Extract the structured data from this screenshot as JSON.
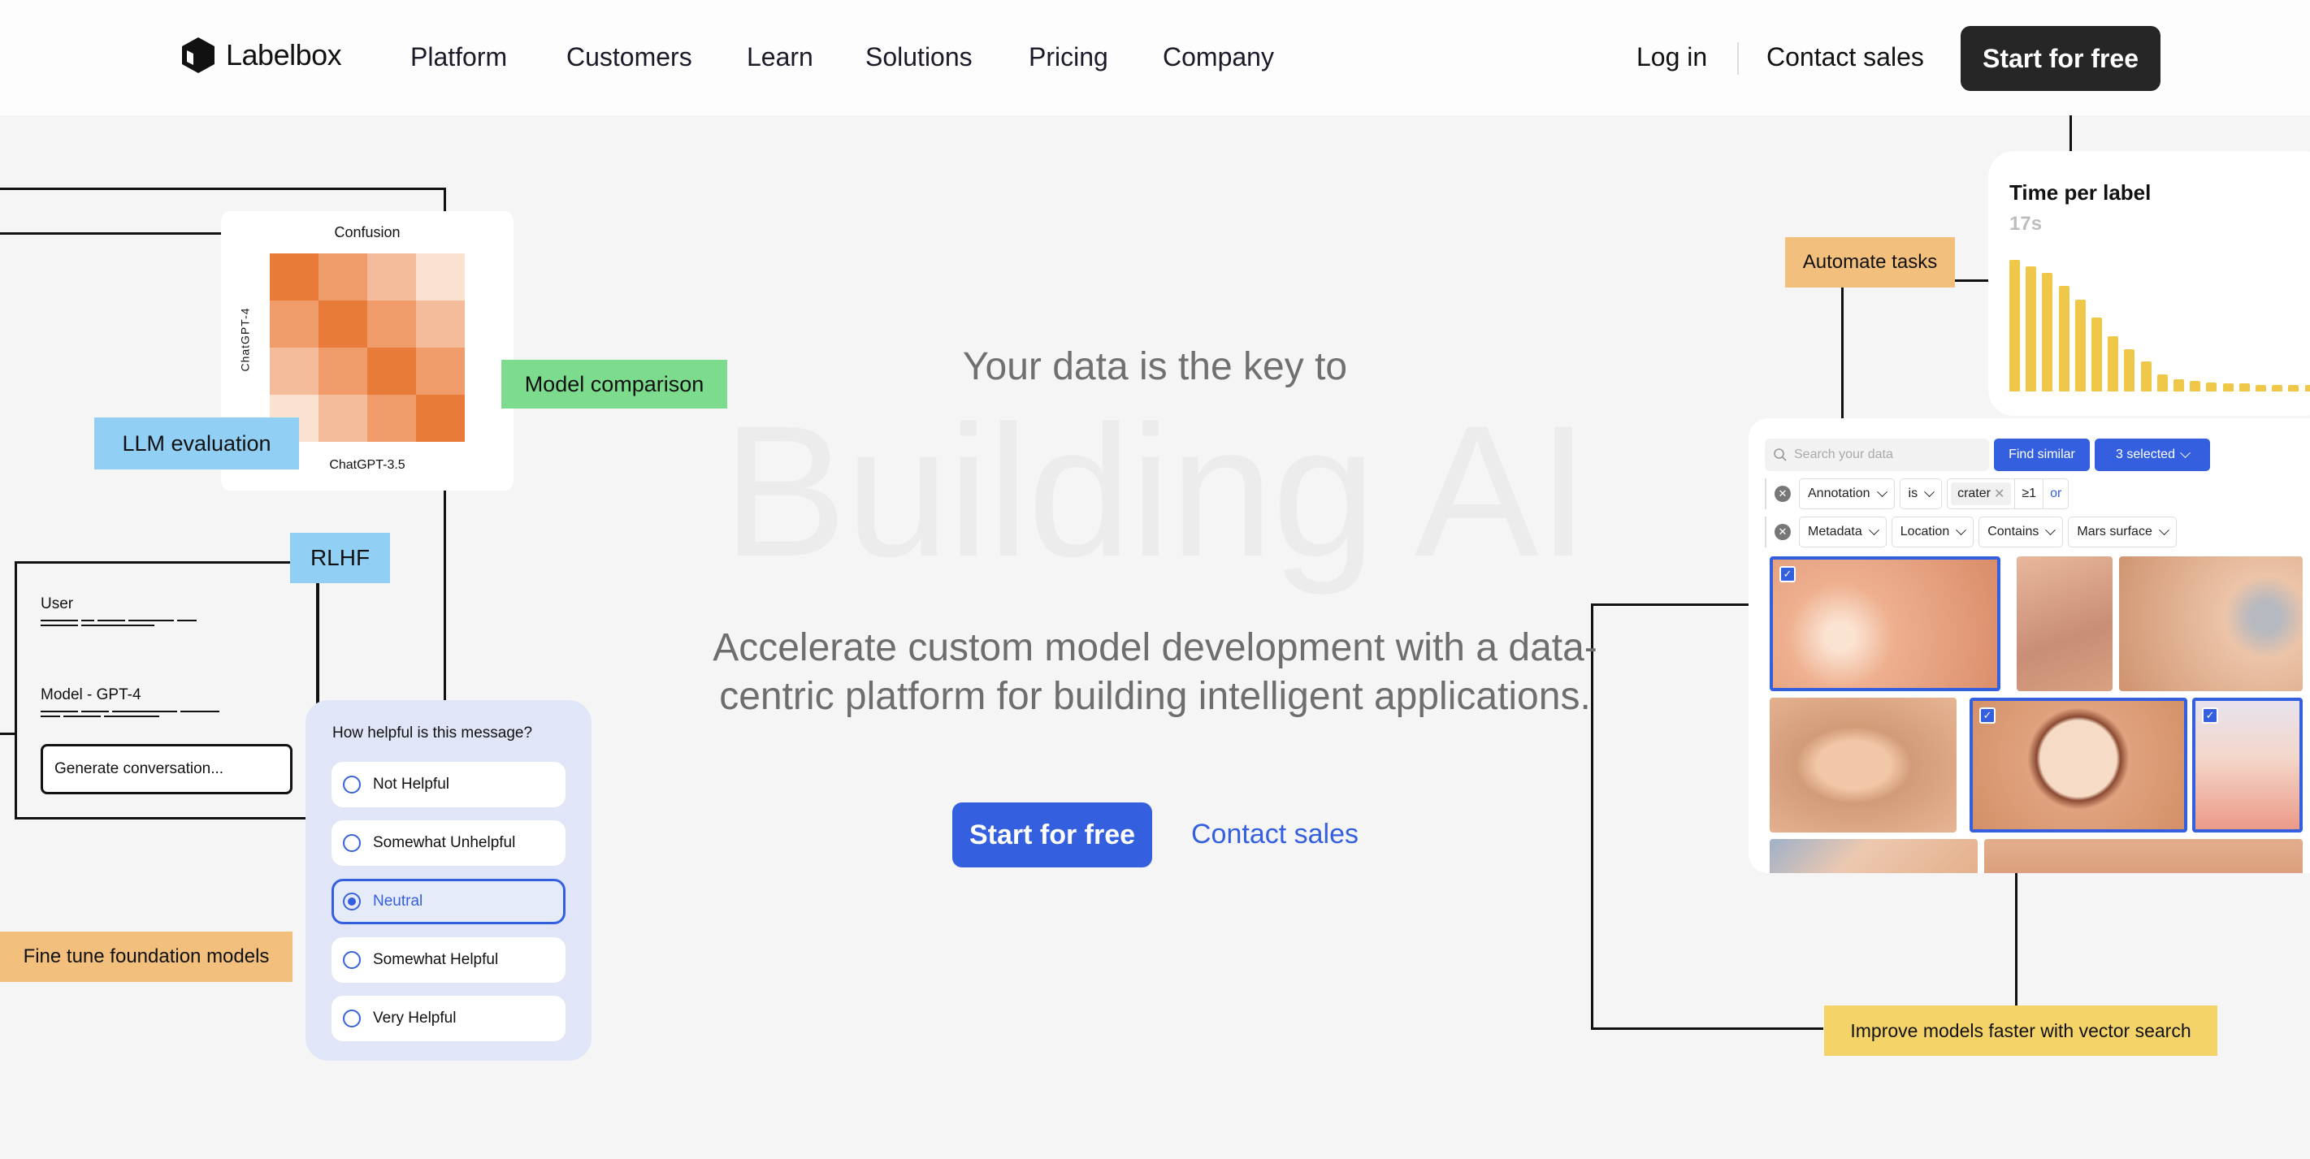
{
  "header": {
    "brand": "Labelbox",
    "nav": [
      "Platform",
      "Customers",
      "Learn",
      "Solutions",
      "Pricing",
      "Company"
    ],
    "login": "Log in",
    "contact_sales": "Contact sales",
    "start_free": "Start for free"
  },
  "hero": {
    "kicker": "Your data is the key to",
    "headline": "Building AI",
    "subtitle": "Accelerate custom model development with a data-centric platform for building intelligent applications.",
    "primary_cta": "Start for free",
    "secondary_cta": "Contact sales"
  },
  "tags": {
    "llm_evaluation": "LLM evaluation",
    "model_comparison": "Model comparison",
    "rlhf": "RLHF",
    "fine_tune": "Fine tune foundation models",
    "automate_tasks": "Automate tasks",
    "vector_search": "Improve models faster with vector search"
  },
  "confusion": {
    "title": "Confusion",
    "y_label": "ChatGPT-4",
    "x_label": "ChatGPT-3.5",
    "matrix": [
      [
        4,
        3,
        2,
        1
      ],
      [
        3,
        4,
        3,
        2
      ],
      [
        2,
        3,
        4,
        3
      ],
      [
        1,
        2,
        3,
        4
      ]
    ],
    "colors": [
      "#fbe1d0",
      "#f4bc9a",
      "#ef9c6a",
      "#e97b39"
    ]
  },
  "chat": {
    "user_label": "User",
    "model_label": "Model - GPT-4",
    "input_placeholder": "Generate conversation..."
  },
  "survey": {
    "question": "How helpful is this message?",
    "options": [
      "Not Helpful",
      "Somewhat Unhelpful",
      "Neutral",
      "Somewhat Helpful",
      "Very Helpful"
    ],
    "selected": "Neutral"
  },
  "time_per_label": {
    "title": "Time per label",
    "value": "17s"
  },
  "chart_data": {
    "type": "bar",
    "title": "Time per label",
    "values": [
      100,
      95,
      90,
      80,
      70,
      56,
      42,
      32,
      23,
      13,
      9,
      8,
      7,
      6,
      6,
      5,
      5,
      5,
      5
    ],
    "color": "#efc84a"
  },
  "search": {
    "placeholder": "Search your data",
    "find_similar": "Find similar",
    "selected": "3 selected",
    "filter1": {
      "field": "Annotation",
      "op": "is",
      "value": "crater",
      "count": "≥1",
      "or": "or"
    },
    "filter2": {
      "field": "Metadata",
      "key": "Location",
      "op": "Contains",
      "value": "Mars surface"
    },
    "tiles_selected": [
      true,
      false,
      false,
      false,
      true,
      true,
      false,
      false
    ]
  },
  "colors": {
    "accent": "#3460e0",
    "dark_button": "#262626",
    "tag_blue": "#92cff5",
    "tag_green": "#7cdb8c",
    "tag_orange": "#f2bf7d",
    "tag_yellow": "#f4d468"
  }
}
